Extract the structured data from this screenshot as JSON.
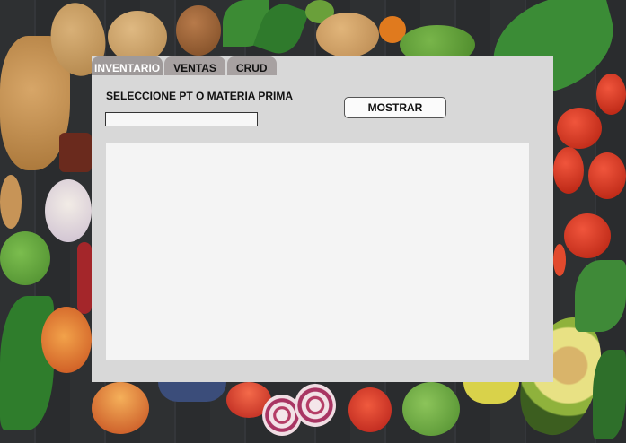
{
  "tabs": [
    {
      "label": "INVENTARIO",
      "active": true
    },
    {
      "label": "VENTAS",
      "active": false
    },
    {
      "label": "CRUD",
      "active": false
    }
  ],
  "form": {
    "select_label": "SELECCIONE PT O MATERIA PRIMA",
    "select_value": "",
    "show_button_label": "MOSTRAR"
  },
  "colors": {
    "window_bg": "#d8d8d8",
    "tab_bg": "#a7a1a1",
    "results_bg": "#f4f4f4"
  }
}
